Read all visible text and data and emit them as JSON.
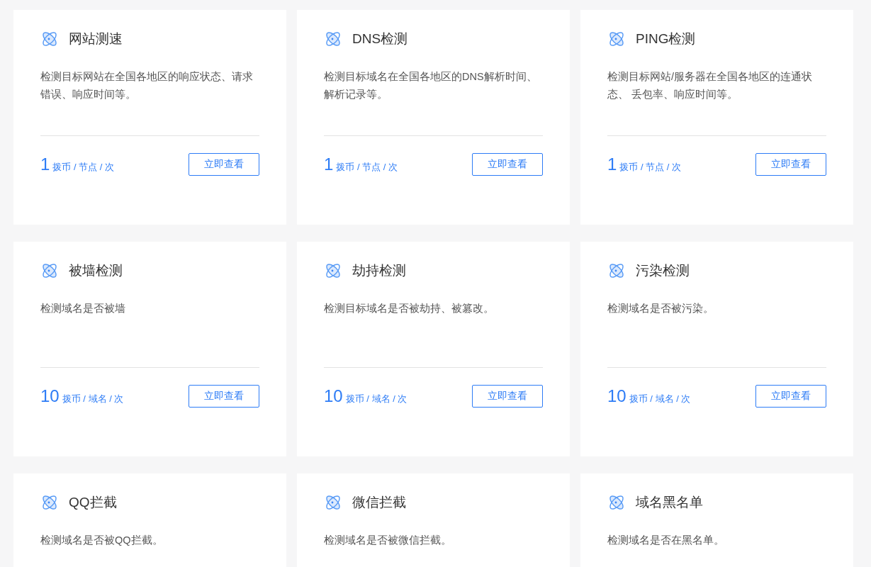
{
  "cards": [
    {
      "title": "网站测速",
      "description": "检测目标网站在全国各地区的响应状态、请求错误、响应时间等。",
      "price": "1",
      "unit": "拨币 / 节点 / 次",
      "button": "立即查看"
    },
    {
      "title": "DNS检测",
      "description": "检测目标域名在全国各地区的DNS解析时间、解析记录等。",
      "price": "1",
      "unit": "拨币 / 节点 / 次",
      "button": "立即查看"
    },
    {
      "title": "PING检测",
      "description": "检测目标网站/服务器在全国各地区的连通状态、 丢包率、响应时间等。",
      "price": "1",
      "unit": "拨币 / 节点 / 次",
      "button": "立即查看"
    },
    {
      "title": "被墙检测",
      "description": "检测域名是否被墙",
      "price": "10",
      "unit": "拨币 / 域名 / 次",
      "button": "立即查看"
    },
    {
      "title": "劫持检测",
      "description": "检测目标域名是否被劫持、被篡改。",
      "price": "10",
      "unit": "拨币 / 域名 / 次",
      "button": "立即查看"
    },
    {
      "title": "污染检测",
      "description": "检测域名是否被污染。",
      "price": "10",
      "unit": "拨币 / 域名 / 次",
      "button": "立即查看"
    },
    {
      "title": "QQ拦截",
      "description": "检测域名是否被QQ拦截。"
    },
    {
      "title": "微信拦截",
      "description": "检测域名是否被微信拦截。"
    },
    {
      "title": "域名黑名单",
      "description": "检测域名是否在黑名单。"
    }
  ]
}
